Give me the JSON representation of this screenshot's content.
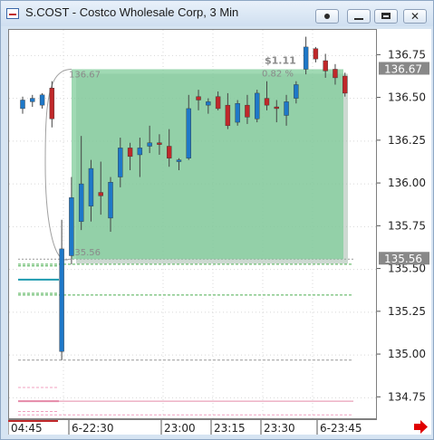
{
  "window": {
    "title": "S.COST - Costco Wholesale Corp, 3 Min",
    "buttons": [
      "dot-button",
      "minimize-button",
      "maximize-button",
      "close-button"
    ]
  },
  "chart_data": {
    "type": "candlestick",
    "symbol": "S.COST",
    "interval": "3 Min",
    "ylim": [
      134.63,
      136.9
    ],
    "price_ticks": [
      "136.75",
      "136.50",
      "136.25",
      "136.00",
      "135.75",
      "135.50",
      "135.25",
      "135.00",
      "134.75"
    ],
    "time_ticks": [
      "04:45",
      "6-22:30",
      "23:00",
      "23:15",
      "23:30",
      "6-23:45"
    ],
    "price_labels": [
      {
        "text": "136.67",
        "bg": "#888888"
      },
      {
        "text": "135.56",
        "bg": "#888888"
      }
    ],
    "measure_box": {
      "top_price": 136.67,
      "bottom_price": 135.56,
      "top_label": "136.67",
      "bottom_label": "135.56",
      "change": "$1.11",
      "change_pct": "0.82 %",
      "fill": "#7fcc99"
    },
    "colors": {
      "up": "#1e78c8",
      "down": "#c0282a",
      "axis_arrow": "#e00000"
    },
    "candles": [
      {
        "o": 136.44,
        "h": 136.51,
        "l": 136.41,
        "c": 136.49
      },
      {
        "o": 136.48,
        "h": 136.52,
        "l": 136.45,
        "c": 136.5
      },
      {
        "o": 136.46,
        "h": 136.53,
        "l": 136.44,
        "c": 136.52
      },
      {
        "o": 136.56,
        "h": 136.6,
        "l": 136.33,
        "c": 136.38
      },
      {
        "o": 135.02,
        "h": 135.79,
        "l": 134.97,
        "c": 135.62
      },
      {
        "o": 135.58,
        "h": 136.04,
        "l": 135.53,
        "c": 135.92
      },
      {
        "o": 135.78,
        "h": 136.28,
        "l": 135.73,
        "c": 136.0
      },
      {
        "o": 135.87,
        "h": 136.14,
        "l": 135.78,
        "c": 136.09
      },
      {
        "o": 135.95,
        "h": 136.13,
        "l": 135.82,
        "c": 135.93
      },
      {
        "o": 135.8,
        "h": 136.04,
        "l": 135.72,
        "c": 136.01
      },
      {
        "o": 136.04,
        "h": 136.27,
        "l": 135.98,
        "c": 136.21
      },
      {
        "o": 136.21,
        "h": 136.24,
        "l": 136.08,
        "c": 136.16
      },
      {
        "o": 136.17,
        "h": 136.27,
        "l": 136.04,
        "c": 136.21
      },
      {
        "o": 136.22,
        "h": 136.34,
        "l": 136.18,
        "c": 136.24
      },
      {
        "o": 136.24,
        "h": 136.29,
        "l": 136.17,
        "c": 136.23
      },
      {
        "o": 136.22,
        "h": 136.32,
        "l": 136.1,
        "c": 136.15
      },
      {
        "o": 136.13,
        "h": 136.15,
        "l": 136.08,
        "c": 136.14
      },
      {
        "o": 136.15,
        "h": 136.52,
        "l": 136.14,
        "c": 136.44
      },
      {
        "o": 136.51,
        "h": 136.55,
        "l": 136.43,
        "c": 136.49
      },
      {
        "o": 136.46,
        "h": 136.5,
        "l": 136.41,
        "c": 136.48
      },
      {
        "o": 136.51,
        "h": 136.54,
        "l": 136.43,
        "c": 136.44
      },
      {
        "o": 136.46,
        "h": 136.53,
        "l": 136.32,
        "c": 136.34
      },
      {
        "o": 136.36,
        "h": 136.49,
        "l": 136.34,
        "c": 136.47
      },
      {
        "o": 136.46,
        "h": 136.52,
        "l": 136.35,
        "c": 136.39
      },
      {
        "o": 136.38,
        "h": 136.55,
        "l": 136.36,
        "c": 136.53
      },
      {
        "o": 136.5,
        "h": 136.6,
        "l": 136.43,
        "c": 136.46
      },
      {
        "o": 136.45,
        "h": 136.49,
        "l": 136.36,
        "c": 136.44
      },
      {
        "o": 136.4,
        "h": 136.52,
        "l": 136.34,
        "c": 136.48
      },
      {
        "o": 136.5,
        "h": 136.6,
        "l": 136.47,
        "c": 136.58
      },
      {
        "o": 136.67,
        "h": 136.86,
        "l": 136.64,
        "c": 136.8
      },
      {
        "o": 136.79,
        "h": 136.8,
        "l": 136.71,
        "c": 136.73
      },
      {
        "o": 136.72,
        "h": 136.76,
        "l": 136.62,
        "c": 136.66
      },
      {
        "o": 136.67,
        "h": 136.7,
        "l": 136.58,
        "c": 136.62
      },
      {
        "o": 136.63,
        "h": 136.65,
        "l": 136.51,
        "c": 136.53
      }
    ],
    "ref_lines": [
      {
        "price": 135.56,
        "color": "#999999",
        "dash": "2,2"
      },
      {
        "price": 135.53,
        "color": "#4caf50",
        "dash": "3,2"
      },
      {
        "price": 135.35,
        "color": "#4caf50",
        "dash": "3,2"
      },
      {
        "price": 134.97,
        "color": "#999999",
        "dash": "3,2"
      },
      {
        "price": 134.73,
        "color": "#e58aa8",
        "dash": ""
      },
      {
        "price": 134.65,
        "color": "#f0a0c0",
        "dash": "3,2"
      }
    ],
    "left_levels": [
      {
        "price": 135.52,
        "color": "#4caf50",
        "dash": "3,2"
      },
      {
        "price": 135.44,
        "color": "#1e9bb0",
        "dash": ""
      },
      {
        "price": 135.36,
        "color": "#4caf50",
        "dash": "3,2"
      },
      {
        "price": 134.81,
        "color": "#f0a0c0",
        "dash": "3,2"
      },
      {
        "price": 134.73,
        "color": "#e58aa8",
        "dash": ""
      },
      {
        "price": 134.67,
        "color": "#f0a0c0",
        "dash": "3,2"
      }
    ]
  }
}
